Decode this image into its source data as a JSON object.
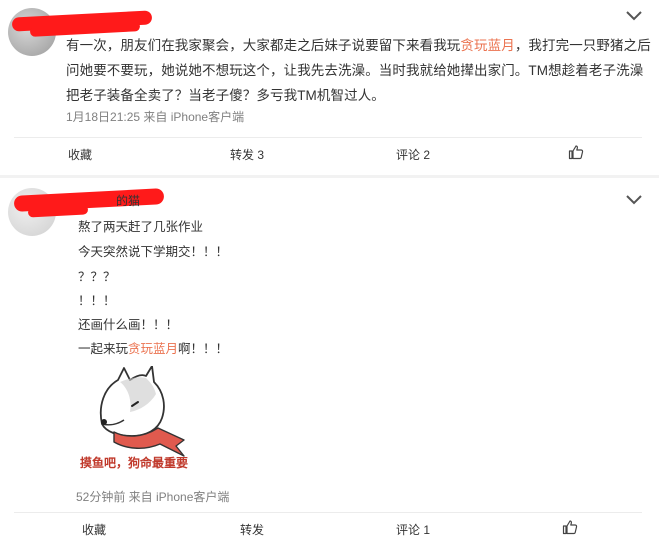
{
  "posts": [
    {
      "username": "",
      "content_prefix": "有一次，朋友们在我家聚会，大家都走之后妹子说要留下来看我玩",
      "content_highlight": "贪玩蓝月",
      "content_suffix": "，我打完一只野猪之后问她要不要玩，她说她不想玩这个，让我先去洗澡。当时我就给她撵出家门。TM想趁着老子洗澡把老子装备全卖了？当老子傻？多亏我TM机智过人。",
      "meta": "1月18日21:25 来自 iPhone客户端",
      "actions": {
        "favorite": "收藏",
        "repost": "转发 3",
        "comment": "评论 2"
      }
    },
    {
      "username": "的猫",
      "lines": [
        "熬了两天赶了几张作业",
        "今天突然说下学期交！！！",
        "？？？",
        "！！！",
        "还画什么画！！！"
      ],
      "last_prefix": "一起来玩",
      "last_highlight": "贪玩蓝月",
      "last_suffix": "啊！！！",
      "sticker_caption": "摸鱼吧，狗命最重要",
      "meta": "52分钟前 来自 iPhone客户端",
      "actions": {
        "favorite": "收藏",
        "repost": "转发",
        "comment": "评论 1"
      }
    }
  ],
  "colors": {
    "highlight": "#eb7350",
    "redaction": "#ff1a1a",
    "meta": "#808080"
  },
  "icons": [
    "chevron-down-icon",
    "thumbs-up-icon",
    "shiba-dog-sticker"
  ]
}
